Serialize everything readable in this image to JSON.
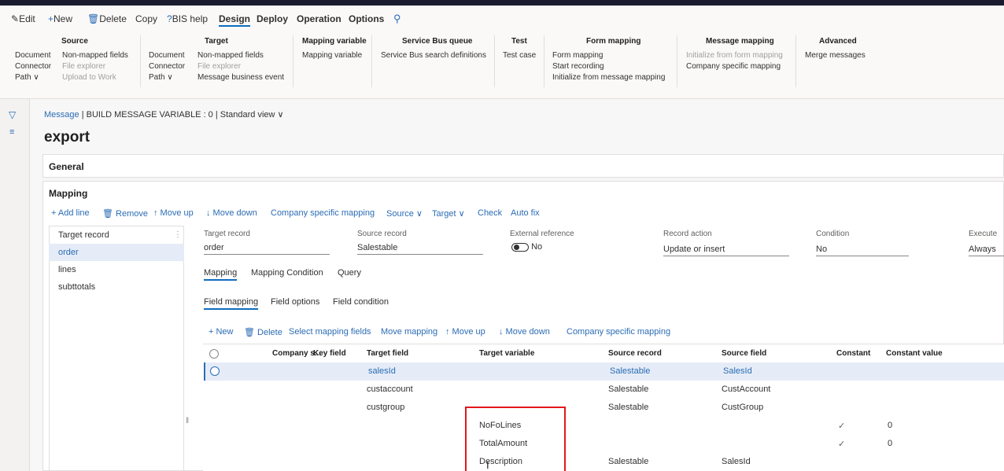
{
  "actionbar": {
    "edit": "Edit",
    "new": "New",
    "delete": "Delete",
    "copy": "Copy",
    "bis_help": "BIS help",
    "design": "Design",
    "deploy": "Deploy",
    "operation": "Operation",
    "options": "Options"
  },
  "ribbon": {
    "source": {
      "title": "Source",
      "col1": [
        "Document",
        "Connector",
        "Path ∨"
      ],
      "col2": [
        "Non-mapped fields",
        "File explorer",
        "Upload to Work"
      ]
    },
    "target": {
      "title": "Target",
      "col1": [
        "Document",
        "Connector",
        "Path ∨"
      ],
      "col2": [
        "Non-mapped fields",
        "File explorer",
        "Message business event"
      ]
    },
    "mapping_variable": {
      "title": "Mapping variable",
      "items": [
        "Mapping variable"
      ]
    },
    "service_bus": {
      "title": "Service Bus queue",
      "items": [
        "Service Bus search definitions"
      ]
    },
    "test": {
      "title": "Test",
      "items": [
        "Test case"
      ]
    },
    "form_mapping": {
      "title": "Form mapping",
      "items": [
        "Form mapping",
        "Start recording",
        "Initialize from message mapping"
      ]
    },
    "message_mapping": {
      "title": "Message mapping",
      "items": [
        "Initialize from form mapping",
        "Company specific mapping"
      ]
    },
    "advanced": {
      "title": "Advanced",
      "items": [
        "Merge messages"
      ]
    }
  },
  "breadcrumb": {
    "message": "Message",
    "rest": "|  BUILD MESSAGE VARIABLE : 0  |  Standard view ∨"
  },
  "page_title": "export",
  "sections": {
    "general": "General",
    "mapping": "Mapping"
  },
  "mapping_toolbar": [
    "+ Add line",
    "Remove",
    "↑ Move up",
    "↓ Move down",
    "Company specific mapping",
    "Source ∨",
    "Target ∨",
    "Check",
    "Auto fix"
  ],
  "records": {
    "header": "Target record",
    "items": [
      "order",
      "lines",
      "subttotals"
    ],
    "selected_index": 0
  },
  "details": {
    "target_record": {
      "label": "Target record",
      "value": "order"
    },
    "source_record": {
      "label": "Source record",
      "value": "Salestable"
    },
    "external_reference": {
      "label": "External reference",
      "value": "No"
    },
    "record_action": {
      "label": "Record action",
      "value": "Update or insert"
    },
    "condition": {
      "label": "Condition",
      "value": "No"
    },
    "execute": {
      "label": "Execute",
      "value": "Always"
    }
  },
  "tabs": [
    "Mapping",
    "Mapping Condition",
    "Query"
  ],
  "subtabs": [
    "Field mapping",
    "Field options",
    "Field condition"
  ],
  "field_toolbar": [
    "+ New",
    "Delete",
    "Select mapping fields",
    "Move mapping",
    "↑ Move up",
    "↓ Move down",
    "Company specific mapping"
  ],
  "grid": {
    "headers": [
      "Company s...",
      "Key field",
      "Target field",
      "Target variable",
      "Source record",
      "Source field",
      "Constant",
      "Constant value"
    ],
    "rows": [
      {
        "target_field": "salesId",
        "target_variable": "",
        "source_record": "Salestable",
        "source_field": "SalesId",
        "constant": "",
        "constant_value": ""
      },
      {
        "target_field": "custaccount",
        "target_variable": "",
        "source_record": "Salestable",
        "source_field": "CustAccount",
        "constant": "",
        "constant_value": ""
      },
      {
        "target_field": "custgroup",
        "target_variable": "",
        "source_record": "Salestable",
        "source_field": "CustGroup",
        "constant": "",
        "constant_value": ""
      },
      {
        "target_field": "",
        "target_variable": "NoFoLines",
        "source_record": "",
        "source_field": "",
        "constant": "✓",
        "constant_value": "0"
      },
      {
        "target_field": "",
        "target_variable": "TotalAmount",
        "source_record": "",
        "source_field": "",
        "constant": "✓",
        "constant_value": "0"
      },
      {
        "target_field": "",
        "target_variable": "Description",
        "source_record": "Salestable",
        "source_field": "SalesId",
        "constant": "",
        "constant_value": ""
      }
    ]
  },
  "colors": {
    "accent": "#2b6cb5",
    "selected_row": "#e5ecf7",
    "highlight_box": "#e3171b"
  }
}
